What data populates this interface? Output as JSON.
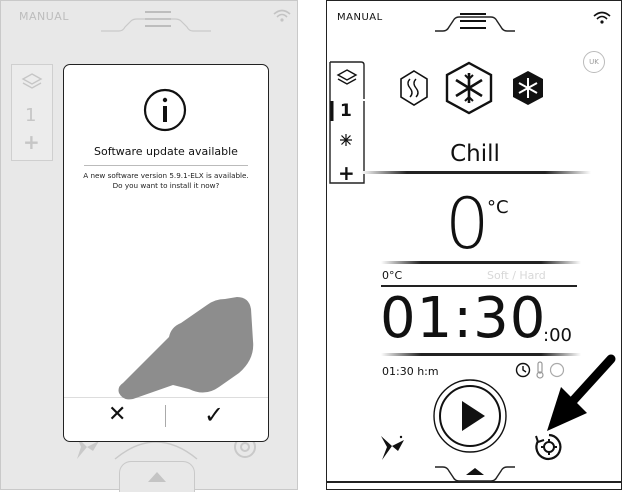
{
  "left_screen": {
    "mode": "MANUAL",
    "program_number": "1",
    "add_label": "+",
    "modal": {
      "title": "Software update available",
      "message": "A new software version 5.9.1-ELX is available. Do you want to install it now?",
      "cancel_label": "✕",
      "confirm_label": "✓",
      "icon": "info-icon"
    },
    "pointer": "pointing-hand-icon"
  },
  "right_screen": {
    "mode": "MANUAL",
    "language_badge": "UK",
    "program_number": "1",
    "add_label": "+",
    "modes": [
      "heat-waves-icon",
      "snowflake-outline-icon",
      "snowflake-solid-icon"
    ],
    "mode_title": "Chill",
    "temperature": {
      "value": "0",
      "unit": "°C",
      "row_label": "0°C",
      "soft_hard_label": "Soft / Hard"
    },
    "time": {
      "main": "01:30",
      "seconds": ":00",
      "row_label": "01:30 h:m"
    },
    "arrow_indicator": "pointer-arrow-icon"
  },
  "colors": {
    "dimmed_background": "#e8e8e8",
    "foreground": "#111111",
    "muted": "#bdbdbd"
  }
}
